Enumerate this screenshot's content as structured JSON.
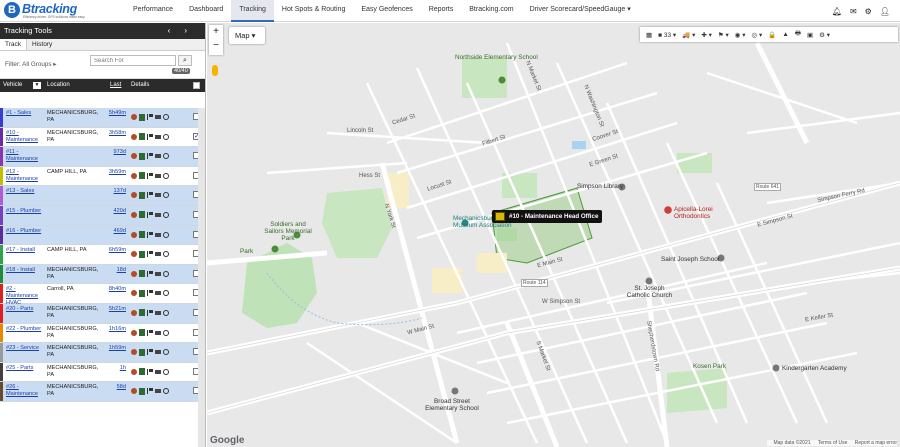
{
  "app": {
    "logo_mark": "B",
    "logo_name": "Btracking",
    "logo_tagline": "Efficiency driven. GPS solutions made easy."
  },
  "nav": [
    {
      "label": "Performance",
      "active": false
    },
    {
      "label": "Dashboard",
      "active": false
    },
    {
      "label": "Tracking",
      "active": true
    },
    {
      "label": "Hot Spots & Routing",
      "active": false
    },
    {
      "label": "Easy Geofences",
      "active": false
    },
    {
      "label": "Reports",
      "active": false
    },
    {
      "label": "Btracking.com",
      "active": false
    },
    {
      "label": "Driver Scorecard/SpeedGauge ▾",
      "active": false
    }
  ],
  "top_icons": [
    "bell-icon",
    "mail-icon",
    "gear-icon",
    "user-icon"
  ],
  "panel": {
    "title": "Tracking Tools",
    "tabs": [
      "Track",
      "History"
    ],
    "filter_label": "Filter: All Groups ▸",
    "search_placeholder": "Search For",
    "count": "40/40",
    "columns": {
      "vehicle": "Vehicle",
      "location": "Location",
      "last": "Last",
      "details": "Details"
    }
  },
  "vehicles": [
    {
      "name": "#1 - Sales",
      "location": "MECHANICSBURG, PA",
      "last": "5h49m",
      "stripe": "#3b3bcf",
      "bg": "blue",
      "checked": false
    },
    {
      "name": "#10 - Maintenance",
      "location": "MECHANICSBURG, PA",
      "last": "3h58m",
      "stripe": "#6a2da8",
      "bg": "white",
      "checked": true
    },
    {
      "name": "#11 - Maintenance",
      "location": "",
      "last": "973d",
      "stripe": "#8c33b0",
      "bg": "blue",
      "checked": false
    },
    {
      "name": "#12 - Maintenance",
      "location": "CAMP HILL, PA",
      "last": "3h59m",
      "stripe": "#c0c000",
      "bg": "white",
      "checked": false
    },
    {
      "name": "#13 - Sales",
      "location": "",
      "last": "137d",
      "stripe": "#b05ad6",
      "bg": "blue",
      "checked": false
    },
    {
      "name": "#15 - Plumber",
      "location": "",
      "last": "420d",
      "stripe": "#7a3fbf",
      "bg": "blue",
      "checked": false
    },
    {
      "name": "#16 - Plumber",
      "location": "",
      "last": "469d",
      "stripe": "#5b2d9c",
      "bg": "blue",
      "checked": false
    },
    {
      "name": "#17 - Install",
      "location": "CAMP HILL, PA",
      "last": "6h59m",
      "stripe": "#2fa34a",
      "bg": "white",
      "checked": false
    },
    {
      "name": "#18 - Install",
      "location": "MECHANICSBURG, PA",
      "last": "18d",
      "stripe": "#1e8c3a",
      "bg": "blue",
      "checked": false
    },
    {
      "name": "#2 - Maintenance HVAC",
      "location": "Carroll, PA",
      "last": "8h40m",
      "stripe": "#e02020",
      "bg": "white",
      "checked": false
    },
    {
      "name": "#20 - Parts",
      "location": "MECHANICSBURG, PA",
      "last": "5h21m",
      "stripe": "#e02020",
      "bg": "blue",
      "checked": false
    },
    {
      "name": "#22 - Plumber",
      "location": "MECHANICSBURG, PA",
      "last": "1h16m",
      "stripe": "#e88a00",
      "bg": "white",
      "checked": false
    },
    {
      "name": "#23 - Service",
      "location": "MECHANICSBURG, PA",
      "last": "1h59m",
      "stripe": "#9a9a9a",
      "bg": "blue",
      "checked": false
    },
    {
      "name": "#25 - Parts",
      "location": "MECHANICSBURG, PA",
      "last": "1h",
      "stripe": "#404040",
      "bg": "white",
      "checked": false
    },
    {
      "name": "#26 - Maintenance",
      "location": "MECHANICSBURG, PA",
      "last": "58d",
      "stripe": "#6a4a2a",
      "bg": "blue",
      "checked": false
    }
  ],
  "map": {
    "type_button": "Map ▾",
    "toolbar": [
      "▦",
      "■ 33 ▾",
      "🚚 ▾",
      "✚ ▾",
      "⚑ ▾",
      "◉ ▾",
      "◎ ▾",
      "🔒",
      "▲",
      "🖶",
      "▣",
      "⚙ ▾"
    ],
    "geofence_label": "#10 - Maintenance Head Office",
    "pois": {
      "school1": "Northside Elementary School",
      "library": "Simpson Library",
      "museum": "Mechanicsburg Museum Association",
      "ortho": "Apicella-Lorei Orthodontics",
      "memorial": "Soldiers and Sailors Memorial Park",
      "park": "Park",
      "sjschool": "Saint Joseph School",
      "sjchurch": "St. Joseph Catholic Church",
      "kosen": "Kosen Park",
      "kinder": "Kindergarten Academy",
      "broad": "Broad Street Elementary School"
    },
    "streets": [
      "W Simpson St",
      "E Simpson St",
      "W Main St",
      "E Main St",
      "N Washington St",
      "N York St",
      "Simpson Ferry Rd",
      "E Keller St",
      "S Market St",
      "Shepherdstown Rd",
      "N Market St",
      "Lincoln St",
      "Cedar St",
      "Filbert St",
      "Locust St",
      "E Green St",
      "Coover St",
      "Hess St",
      "Route 114",
      "Route 641"
    ],
    "google": "Google",
    "footer": [
      "Map data ©2021",
      "Terms of Use",
      "Report a map error"
    ]
  }
}
